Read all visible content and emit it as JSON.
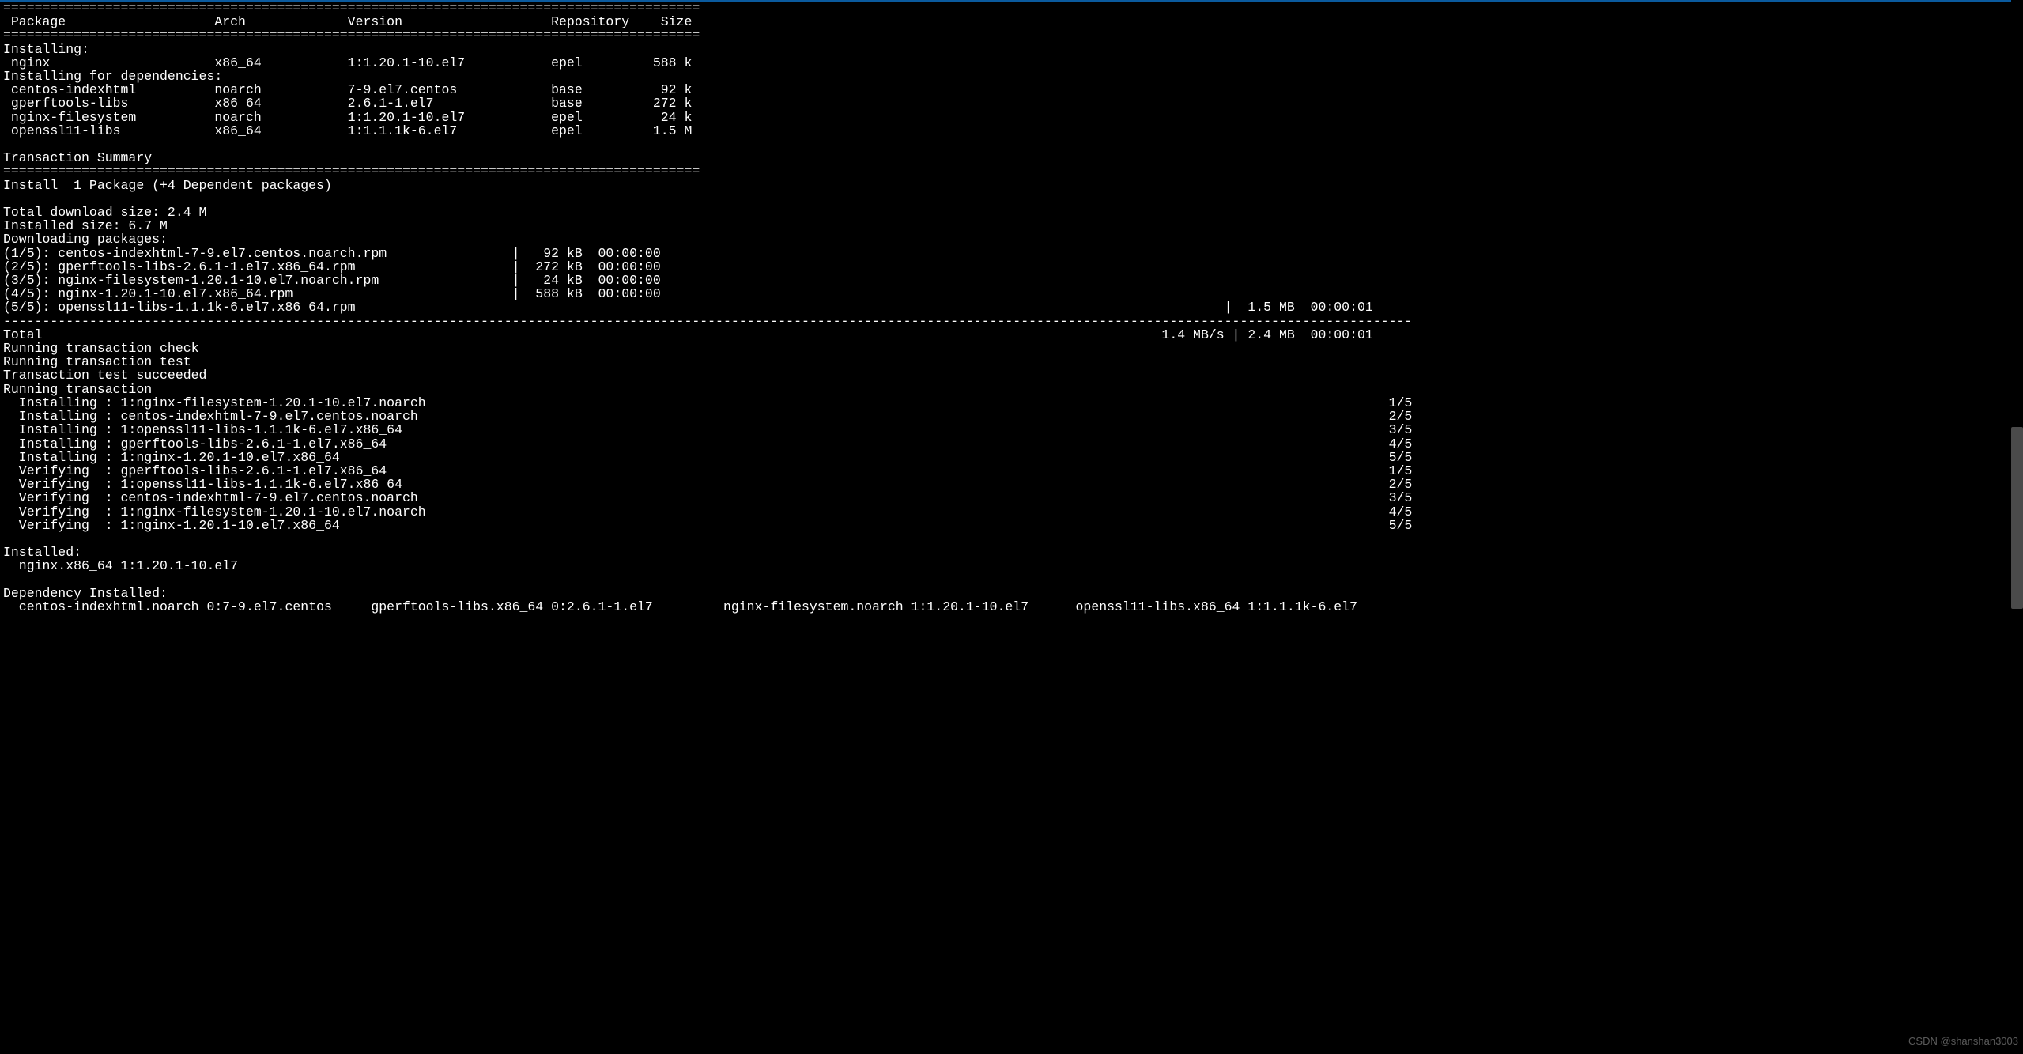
{
  "headers": {
    "package": "Package",
    "arch": "Arch",
    "version": "Version",
    "repository": "Repository",
    "size": "Size"
  },
  "sections": {
    "installing": "Installing:",
    "installing_deps": "Installing for dependencies:",
    "txn_summary": "Transaction Summary",
    "install_line": "Install  1 Package (+4 Dependent packages)",
    "dl_size": "Total download size: 2.4 M",
    "inst_size": "Installed size: 6.7 M",
    "dl_pkgs": "Downloading packages:",
    "total_line_left": "Total",
    "total_line_right": "1.4 MB/s | 2.4 MB  00:00:01",
    "run_check": "Running transaction check",
    "run_test": "Running transaction test",
    "test_succeeded": "Transaction test succeeded",
    "run_txn": "Running transaction",
    "installed_hdr": "Installed:",
    "dep_installed_hdr": "Dependency Installed:"
  },
  "packages": {
    "main": [
      {
        "name": "nginx",
        "arch": "x86_64",
        "version": "1:1.20.1-10.el7",
        "repo": "epel",
        "size": "588 k"
      }
    ],
    "deps": [
      {
        "name": "centos-indexhtml",
        "arch": "noarch",
        "version": "7-9.el7.centos",
        "repo": "base",
        "size": "92 k"
      },
      {
        "name": "gperftools-libs",
        "arch": "x86_64",
        "version": "2.6.1-1.el7",
        "repo": "base",
        "size": "272 k"
      },
      {
        "name": "nginx-filesystem",
        "arch": "noarch",
        "version": "1:1.20.1-10.el7",
        "repo": "epel",
        "size": "24 k"
      },
      {
        "name": "openssl11-libs",
        "arch": "x86_64",
        "version": "1:1.1.1k-6.el7",
        "repo": "epel",
        "size": "1.5 M"
      }
    ]
  },
  "downloads": [
    {
      "idx": "(1/5)",
      "file": "centos-indexhtml-7-9.el7.centos.noarch.rpm",
      "size": "92 kB",
      "time": "00:00:00"
    },
    {
      "idx": "(2/5)",
      "file": "gperftools-libs-2.6.1-1.el7.x86_64.rpm",
      "size": "272 kB",
      "time": "00:00:00"
    },
    {
      "idx": "(3/5)",
      "file": "nginx-filesystem-1.20.1-10.el7.noarch.rpm",
      "size": "24 kB",
      "time": "00:00:00"
    },
    {
      "idx": "(4/5)",
      "file": "nginx-1.20.1-10.el7.x86_64.rpm",
      "size": "588 kB",
      "time": "00:00:00"
    },
    {
      "idx": "(5/5)",
      "file": "openssl11-libs-1.1.1k-6.el7.x86_64.rpm",
      "size": "1.5 MB",
      "time": "00:00:01",
      "wide": true
    }
  ],
  "txn_steps": [
    {
      "action": "Installing",
      "pkg": "1:nginx-filesystem-1.20.1-10.el7.noarch",
      "prog": "1/5"
    },
    {
      "action": "Installing",
      "pkg": "centos-indexhtml-7-9.el7.centos.noarch",
      "prog": "2/5"
    },
    {
      "action": "Installing",
      "pkg": "1:openssl11-libs-1.1.1k-6.el7.x86_64",
      "prog": "3/5"
    },
    {
      "action": "Installing",
      "pkg": "gperftools-libs-2.6.1-1.el7.x86_64",
      "prog": "4/5"
    },
    {
      "action": "Installing",
      "pkg": "1:nginx-1.20.1-10.el7.x86_64",
      "prog": "5/5"
    },
    {
      "action": "Verifying ",
      "pkg": "gperftools-libs-2.6.1-1.el7.x86_64",
      "prog": "1/5"
    },
    {
      "action": "Verifying ",
      "pkg": "1:openssl11-libs-1.1.1k-6.el7.x86_64",
      "prog": "2/5"
    },
    {
      "action": "Verifying ",
      "pkg": "centos-indexhtml-7-9.el7.centos.noarch",
      "prog": "3/5"
    },
    {
      "action": "Verifying ",
      "pkg": "1:nginx-filesystem-1.20.1-10.el7.noarch",
      "prog": "4/5"
    },
    {
      "action": "Verifying ",
      "pkg": "1:nginx-1.20.1-10.el7.x86_64",
      "prog": "5/5"
    }
  ],
  "installed_list": [
    "nginx.x86_64 1:1.20.1-10.el7"
  ],
  "dep_installed_list": [
    "centos-indexhtml.noarch 0:7-9.el7.centos",
    "gperftools-libs.x86_64 0:2.6.1-1.el7",
    "nginx-filesystem.noarch 1:1.20.1-10.el7",
    "openssl11-libs.x86_64 1:1.1.1k-6.el7"
  ],
  "watermark": "CSDN @shanshan3003"
}
